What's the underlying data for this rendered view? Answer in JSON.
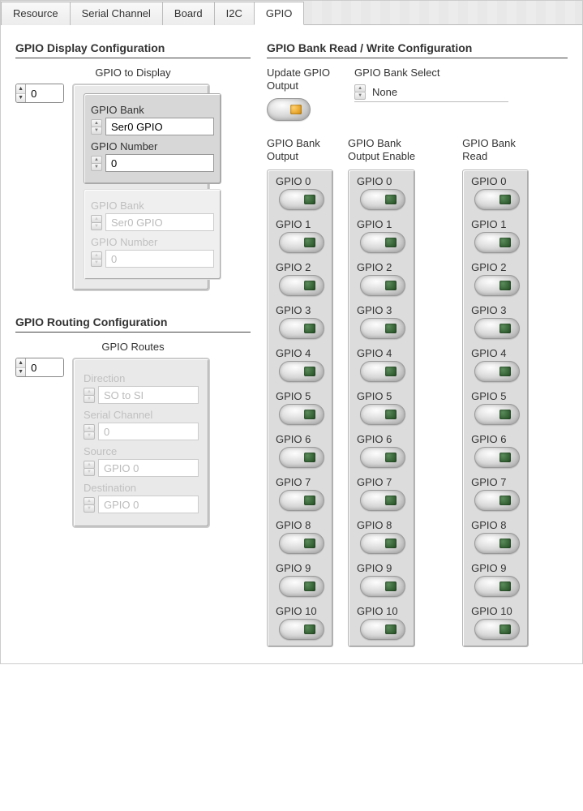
{
  "tabs": [
    "Resource",
    "Serial Channel",
    "Board",
    "I2C",
    "GPIO"
  ],
  "active_tab": "GPIO",
  "left": {
    "display_cfg": {
      "title": "GPIO Display Configuration",
      "subtitle": "GPIO to Display",
      "index_value": "0",
      "active": {
        "bank_label": "GPIO Bank",
        "bank_value": "Ser0 GPIO",
        "num_label": "GPIO Number",
        "num_value": "0"
      },
      "disabled": {
        "bank_label": "GPIO Bank",
        "bank_value": "Ser0 GPIO",
        "num_label": "GPIO Number",
        "num_value": "0"
      }
    },
    "routing_cfg": {
      "title": "GPIO Routing Configuration",
      "subtitle": "GPIO Routes",
      "index_value": "0",
      "dir_label": "Direction",
      "dir_value": "SO to SI",
      "serial_label": "Serial Channel",
      "serial_value": "0",
      "source_label": "Source",
      "source_value": "GPIO 0",
      "dest_label": "Destination",
      "dest_value": "GPIO 0"
    }
  },
  "right": {
    "title": "GPIO Bank Read / Write Configuration",
    "update_label": "Update GPIO\nOutput",
    "bank_select_label": "GPIO Bank Select",
    "bank_select_value": "None",
    "columns": [
      {
        "header": "GPIO Bank\nOutput"
      },
      {
        "header": "GPIO Bank\nOutput Enable"
      },
      {
        "header": "GPIO Bank\nRead"
      }
    ],
    "gpio_labels": [
      "GPIO 0",
      "GPIO 1",
      "GPIO 2",
      "GPIO 3",
      "GPIO 4",
      "GPIO 5",
      "GPIO 6",
      "GPIO 7",
      "GPIO 8",
      "GPIO 9",
      "GPIO 10"
    ]
  }
}
